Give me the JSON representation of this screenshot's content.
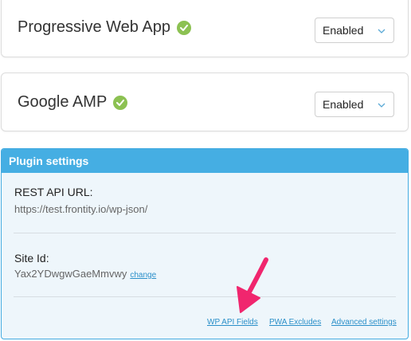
{
  "pwa": {
    "title": "Progressive Web App",
    "status_icon": "check-circle-icon",
    "select_value": "Enabled"
  },
  "amp": {
    "title": "Google AMP",
    "status_icon": "check-circle-icon",
    "select_value": "Enabled"
  },
  "plugin_settings": {
    "header": "Plugin settings",
    "rest_api_label": "REST API URL:",
    "rest_api_value": "https://test.frontity.io/wp-json/",
    "site_id_label": "Site Id:",
    "site_id_value": "Yax2YDwgwGaeMmvwy",
    "change_link": "change",
    "links": {
      "wp_api_fields": "WP API Fields",
      "pwa_excludes": "PWA Excludes",
      "advanced_settings": "Advanced settings"
    }
  },
  "colors": {
    "accent_blue": "#45aee3",
    "check_green": "#8cc152",
    "link_blue": "#2a8fc9",
    "arrow_pink": "#f0266e"
  }
}
